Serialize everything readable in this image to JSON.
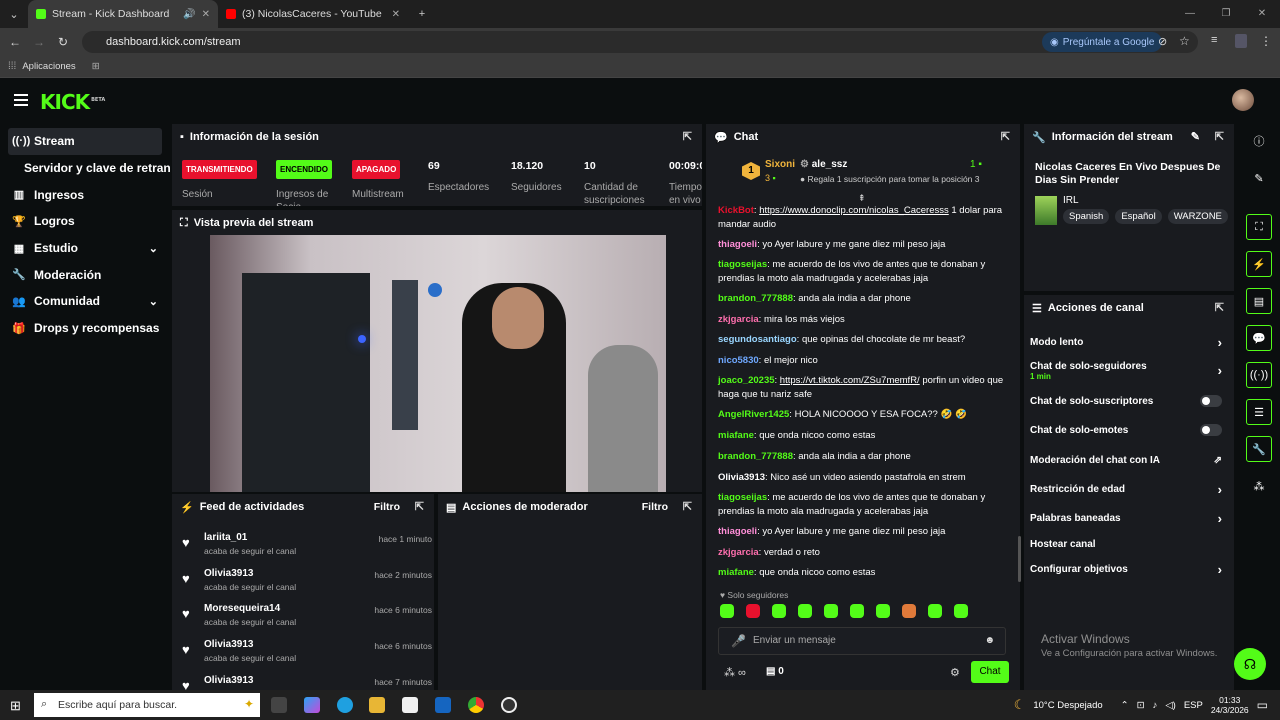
{
  "browser": {
    "tabs": [
      {
        "title": "Stream - Kick Dashboard",
        "favicon_color": "#53fc18"
      },
      {
        "title": "(3) NicolasCaceres - YouTube",
        "favicon_color": "#ff0000"
      }
    ],
    "url": "dashboard.kick.com/stream",
    "ask_google": "Pregúntale a Google",
    "bookmarks_label": "Aplicaciones"
  },
  "header": {
    "logo": "KICK",
    "logo_badge": "BETA"
  },
  "sidebar": {
    "items": [
      {
        "label": "Stream",
        "icon": "broadcast-icon"
      },
      {
        "label": "Servidor y clave de retransmisión"
      },
      {
        "label": "Ingresos",
        "icon": "chart-icon"
      },
      {
        "label": "Logros",
        "icon": "trophy-icon"
      },
      {
        "label": "Estudio",
        "icon": "film-icon"
      },
      {
        "label": "Moderación",
        "icon": "wrench-icon"
      },
      {
        "label": "Comunidad",
        "icon": "people-icon"
      },
      {
        "label": "Drops y recompensas",
        "icon": "gift-icon"
      }
    ]
  },
  "session": {
    "title": "Información de la sesión",
    "badges": [
      {
        "text": "TRANSMITIENDO",
        "label": "Sesión",
        "color": "#e8112d"
      },
      {
        "text": "ENCENDIDO",
        "label": "Ingresos de Socio",
        "color": "#53fc18"
      },
      {
        "text": "APAGADO",
        "label": "Multistream",
        "color": "#e8112d"
      }
    ],
    "stats": [
      {
        "value": "69",
        "label": "Espectadores"
      },
      {
        "value": "18.120",
        "label": "Seguidores"
      },
      {
        "value": "10",
        "label": "Cantidad de suscripciones"
      },
      {
        "value": "00:09:0",
        "label": "Tiempo en vivo"
      }
    ]
  },
  "preview": {
    "title": "Vista previa del stream"
  },
  "activity": {
    "title": "Feed de actividades",
    "filter": "Filtro",
    "items": [
      {
        "name": "lariita_01",
        "desc": "acaba de seguir el canal",
        "time": "hace 1 minuto"
      },
      {
        "name": "Olivia3913",
        "desc": "acaba de seguir el canal",
        "time": "hace 2 minutos"
      },
      {
        "name": "Moresequeira14",
        "desc": "acaba de seguir el canal",
        "time": "hace 6 minutos"
      },
      {
        "name": "Olivia3913",
        "desc": "acaba de seguir el canal",
        "time": "hace 6 minutos"
      },
      {
        "name": "Olivia3913",
        "desc": "",
        "time": "hace 7 minutos"
      }
    ]
  },
  "modactions": {
    "title": "Acciones de moderador",
    "filter": "Filtro"
  },
  "chat": {
    "title": "Chat",
    "pinned": {
      "rank": "1",
      "user1": "Sixoni",
      "count1": "3",
      "user2": "ale_ssz",
      "count2": "1",
      "note": "Regala 1 suscripción para tomar la posición 3"
    },
    "messages": [
      {
        "user": "KickBot",
        "color": "#e8112d",
        "text": "",
        "link": "https://www.donoclip.com/nicolas_Caceresss",
        "after": " 1 dolar para mandar audio"
      },
      {
        "user": "thiagoeli",
        "color": "#ff8fd8",
        "text": "yo Ayer labure y me gane diez mil peso jaja"
      },
      {
        "user": "tiagoseijas",
        "color": "#53fc18",
        "text": "me acuerdo de los vivo de antes que te donaban y prendias la moto ala madrugada y acelerabas jaja"
      },
      {
        "user": "brandon_777888",
        "color": "#53fc18",
        "text": "anda ala india a dar phone"
      },
      {
        "user": "zkjgarcia",
        "color": "#ff6fae",
        "text": "mira los más viejos"
      },
      {
        "user": "segundosantiago",
        "color": "#9ad6ff",
        "text": "que opinas del chocolate de mr beast?"
      },
      {
        "user": "nico5830",
        "color": "#6fa8ff",
        "text": "el mejor nico"
      },
      {
        "user": "joaco_20235",
        "color": "#53fc18",
        "text": "",
        "link": "https://vt.tiktok.com/ZSu7memfR/",
        "after": " porfin un video que haga que tu nariz safe"
      },
      {
        "user": "AngelRiver1425",
        "color": "#53fc18",
        "text": "HOLA NICOOOO Y ESA FOCA?? 🤣 🤣"
      },
      {
        "user": "miafane",
        "color": "#53fc18",
        "text": "que onda nicoo como estas"
      },
      {
        "user": "brandon_777888",
        "color": "#53fc18",
        "text": "anda ala india a dar phone"
      },
      {
        "user": "Olivia3913",
        "color": "#ffffff",
        "text": "Nico asé un video asiendo pastafrola en strem"
      },
      {
        "user": "tiagoseijas",
        "color": "#53fc18",
        "text": "me acuerdo de los vivo de antes que te donaban y prendias la moto ala madrugada y acelerabas jaja"
      },
      {
        "user": "thiagoeli",
        "color": "#ff8fd8",
        "text": "yo Ayer labure y me gane diez mil peso jaja"
      },
      {
        "user": "zkjgarcia",
        "color": "#ff6fae",
        "text": "verdad o reto"
      },
      {
        "user": "miafane",
        "color": "#53fc18",
        "text": "que onda nicoo como estas"
      }
    ],
    "followers_only": "Solo seguidores",
    "input_placeholder": "Enviar un mensaje",
    "points": "0",
    "send_label": "Chat"
  },
  "streaminfo": {
    "title": "Información del stream",
    "stream_title": "Nicolas Caceres En Vivo Despues De Dias Sin Prender",
    "category": "IRL",
    "tags": [
      "Spanish",
      "Español",
      "WARZONE"
    ]
  },
  "channelactions": {
    "title": "Acciones de canal",
    "items": [
      {
        "label": "Modo lento",
        "type": "chevron"
      },
      {
        "label": "Chat de solo-seguidores",
        "sub": "1 min",
        "type": "chevron"
      },
      {
        "label": "Chat de solo-suscriptores",
        "type": "toggle"
      },
      {
        "label": "Chat de solo-emotes",
        "type": "toggle"
      },
      {
        "label": "Moderación del chat con IA",
        "type": "external"
      },
      {
        "label": "Restricción de edad",
        "type": "chevron"
      },
      {
        "label": "Palabras baneadas",
        "type": "chevron"
      },
      {
        "label": "Hostear canal",
        "type": "none"
      },
      {
        "label": "Configurar objetivos",
        "type": "chevron"
      }
    ]
  },
  "watermark": {
    "line1": "Activar Windows",
    "line2": "Ve a Configuración para activar Windows."
  },
  "taskbar": {
    "search_placeholder": "Escribe aquí para buscar.",
    "weather": "10°C  Despejado",
    "lang": "ESP",
    "time": "01:33",
    "date": "24/3/2026"
  },
  "colors": {
    "accent": "#53fc18",
    "live": "#e8112d",
    "panel": "#191b1f",
    "bg": "#0b0e0f"
  }
}
